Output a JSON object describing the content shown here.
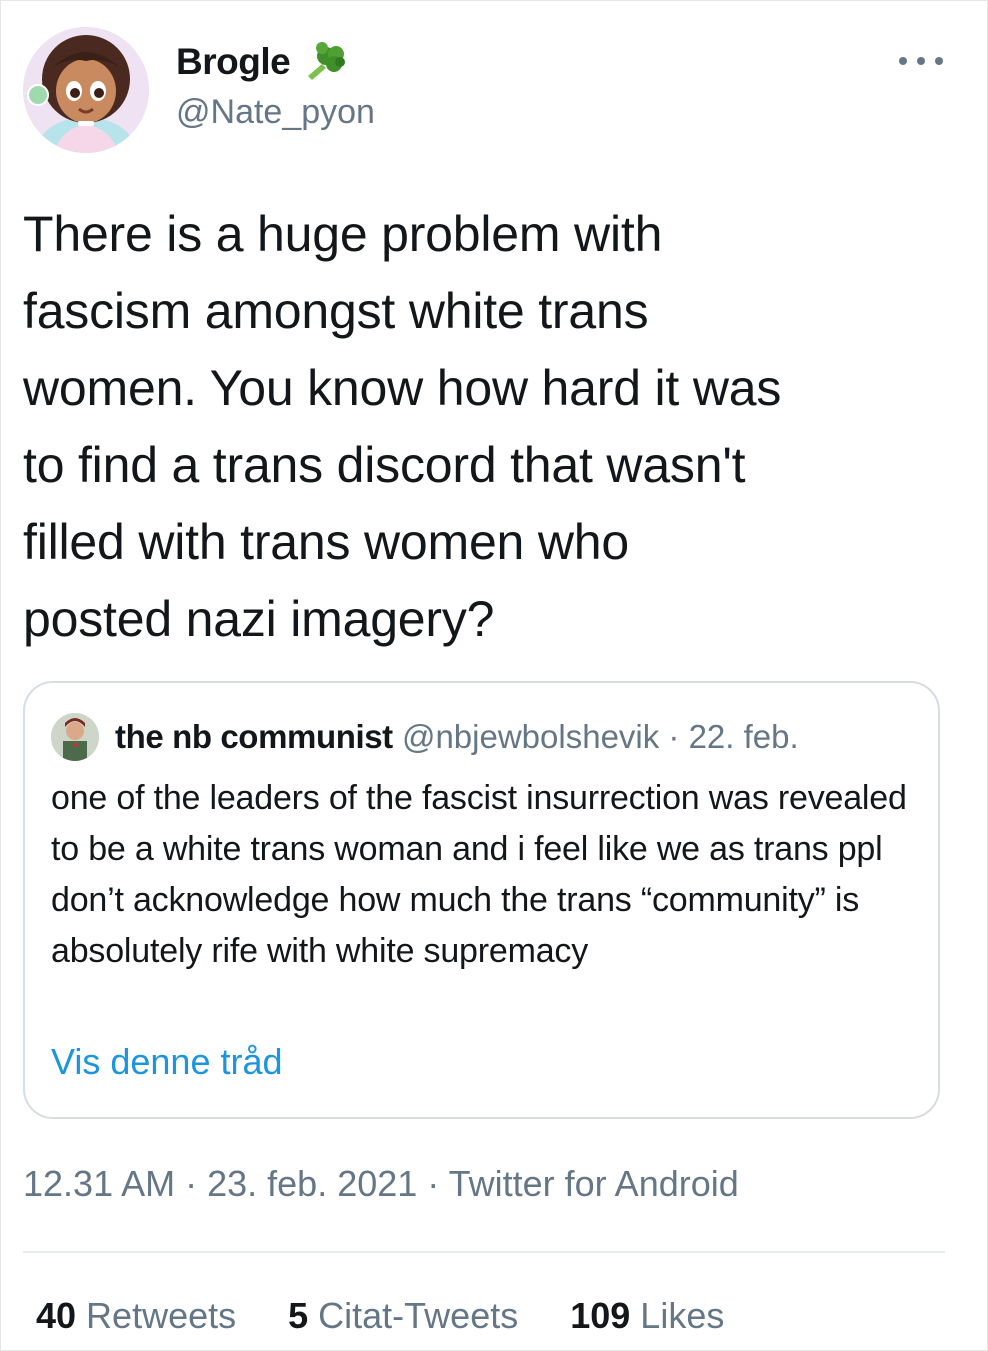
{
  "author": {
    "name": "Brogle",
    "handle": "@Nate_pyon",
    "name_emoji": "broccoli-icon"
  },
  "tweet": {
    "text": "There is a huge problem with\nfascism amongst white trans\nwomen. You know how hard it was\nto find a trans discord that wasn't\nfilled with trans women who\nposted nazi imagery?"
  },
  "quoted": {
    "name": "the nb communist",
    "handle": "@nbjewbolshevik",
    "separator": " · ",
    "date": "22. feb.",
    "text": "one of the leaders of the fascist insurrection was revealed to be a white trans woman and i feel like we as trans ppl don’t acknowledge how much the trans “community” is absolutely rife with white supremacy",
    "thread_link": "Vis denne tråd"
  },
  "meta": {
    "time": "12.31 AM",
    "sep1": " · ",
    "date": "23. feb. 2021",
    "sep2": " · ",
    "source": "Twitter for Android"
  },
  "stats": {
    "retweets_count": "40",
    "retweets_label": " Retweets",
    "quotes_count": "5",
    "quotes_label": " Citat-Tweets",
    "likes_count": "109",
    "likes_label": " Likes"
  },
  "colors": {
    "text": "#14171a",
    "secondary": "#657786",
    "link": "#1b95e0",
    "border": "#d6dde3"
  }
}
